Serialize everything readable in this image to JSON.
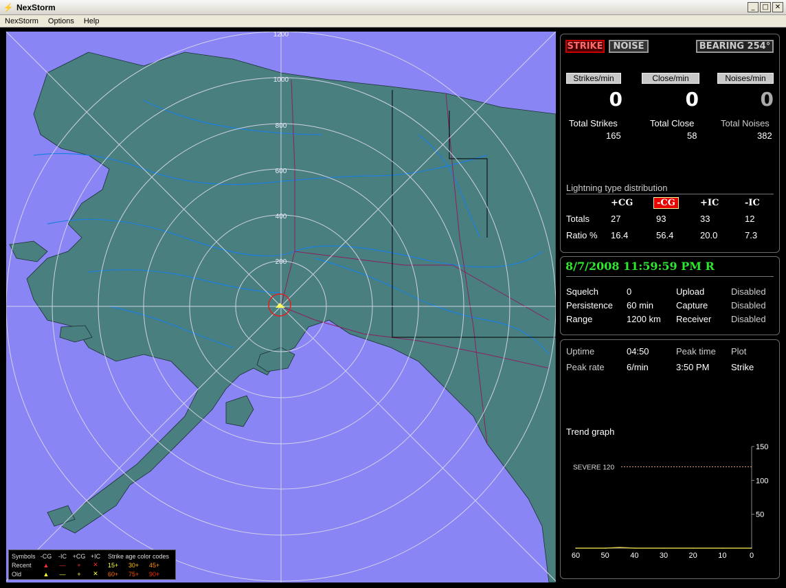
{
  "window": {
    "title": "NexStorm",
    "min": "_",
    "max": "□",
    "close": "✕"
  },
  "menu": [
    "NexStorm",
    "Options",
    "Help"
  ],
  "map": {
    "ring_labels": [
      "1200",
      "1000",
      "800",
      "600",
      "400",
      "200"
    ]
  },
  "legend": {
    "header": [
      "Symbols",
      "-CG",
      "-IC",
      "+CG",
      "+IC",
      "Strike age color codes"
    ],
    "recent_label": "Recent",
    "old_label": "Old",
    "recent_symbols": [
      "▲",
      "—",
      "+",
      "✕"
    ],
    "old_symbols": [
      "▲",
      "—",
      "+",
      "✕"
    ],
    "recent_ages": [
      "15+",
      "30+",
      "45+"
    ],
    "old_ages": [
      "60+",
      "75+",
      "90+"
    ]
  },
  "status": {
    "strike_label": "STRIKE",
    "noise_label": "NOISE",
    "bearing_label": "BEARING 254°",
    "counters": [
      {
        "label": "Strikes/min",
        "value": "0",
        "total_label": "Total Strikes",
        "total": "165"
      },
      {
        "label": "Close/min",
        "value": "0",
        "total_label": "Total Close",
        "total": "58"
      },
      {
        "label": "Noises/min",
        "value": "0",
        "total_label": "Total Noises",
        "total": "382"
      }
    ]
  },
  "distribution": {
    "title": "Lightning type distribution",
    "columns": [
      "+CG",
      "-CG",
      "+IC",
      "-IC"
    ],
    "totals_label": "Totals",
    "totals": [
      "27",
      "93",
      "33",
      "12"
    ],
    "ratio_label": "Ratio %",
    "ratios": [
      "16.4",
      "56.4",
      "20.0",
      "7.3"
    ]
  },
  "settings": {
    "datetime": "8/7/2008 11:59:59 PM R",
    "squelch_label": "Squelch",
    "squelch": "0",
    "persistence_label": "Persistence",
    "persistence": "60 min",
    "range_label": "Range",
    "range": "1200 km",
    "upload_label": "Upload",
    "upload": "Disabled",
    "capture_label": "Capture",
    "capture": "Disabled",
    "receiver_label": "Receiver",
    "receiver": "Disabled"
  },
  "stats": {
    "uptime_label": "Uptime",
    "uptime": "04:50",
    "peak_rate_label": "Peak rate",
    "peak_rate": "6/min",
    "peak_time_label": "Peak time",
    "peak_time": "3:50 PM",
    "plot_label": "Plot",
    "plot": "Strike",
    "trend_label": "Trend graph"
  },
  "chart_data": {
    "type": "line",
    "title": "Trend graph",
    "x_ticks": [
      "60",
      "50",
      "40",
      "30",
      "20",
      "10",
      "0"
    ],
    "y_ticks": [
      "150",
      "100",
      "50"
    ],
    "xlim": [
      60,
      0
    ],
    "ylim": [
      0,
      150
    ],
    "threshold_label": "SEVERE 120",
    "threshold": 120,
    "series": [
      {
        "x": [
          60,
          50,
          45,
          40,
          30,
          20,
          10,
          0
        ],
        "values": [
          0,
          0,
          1,
          0,
          0,
          0,
          0,
          0
        ]
      }
    ],
    "colors": {
      "line": "#d8c84a",
      "threshold": "#e8a080",
      "axis": "#888888"
    }
  }
}
